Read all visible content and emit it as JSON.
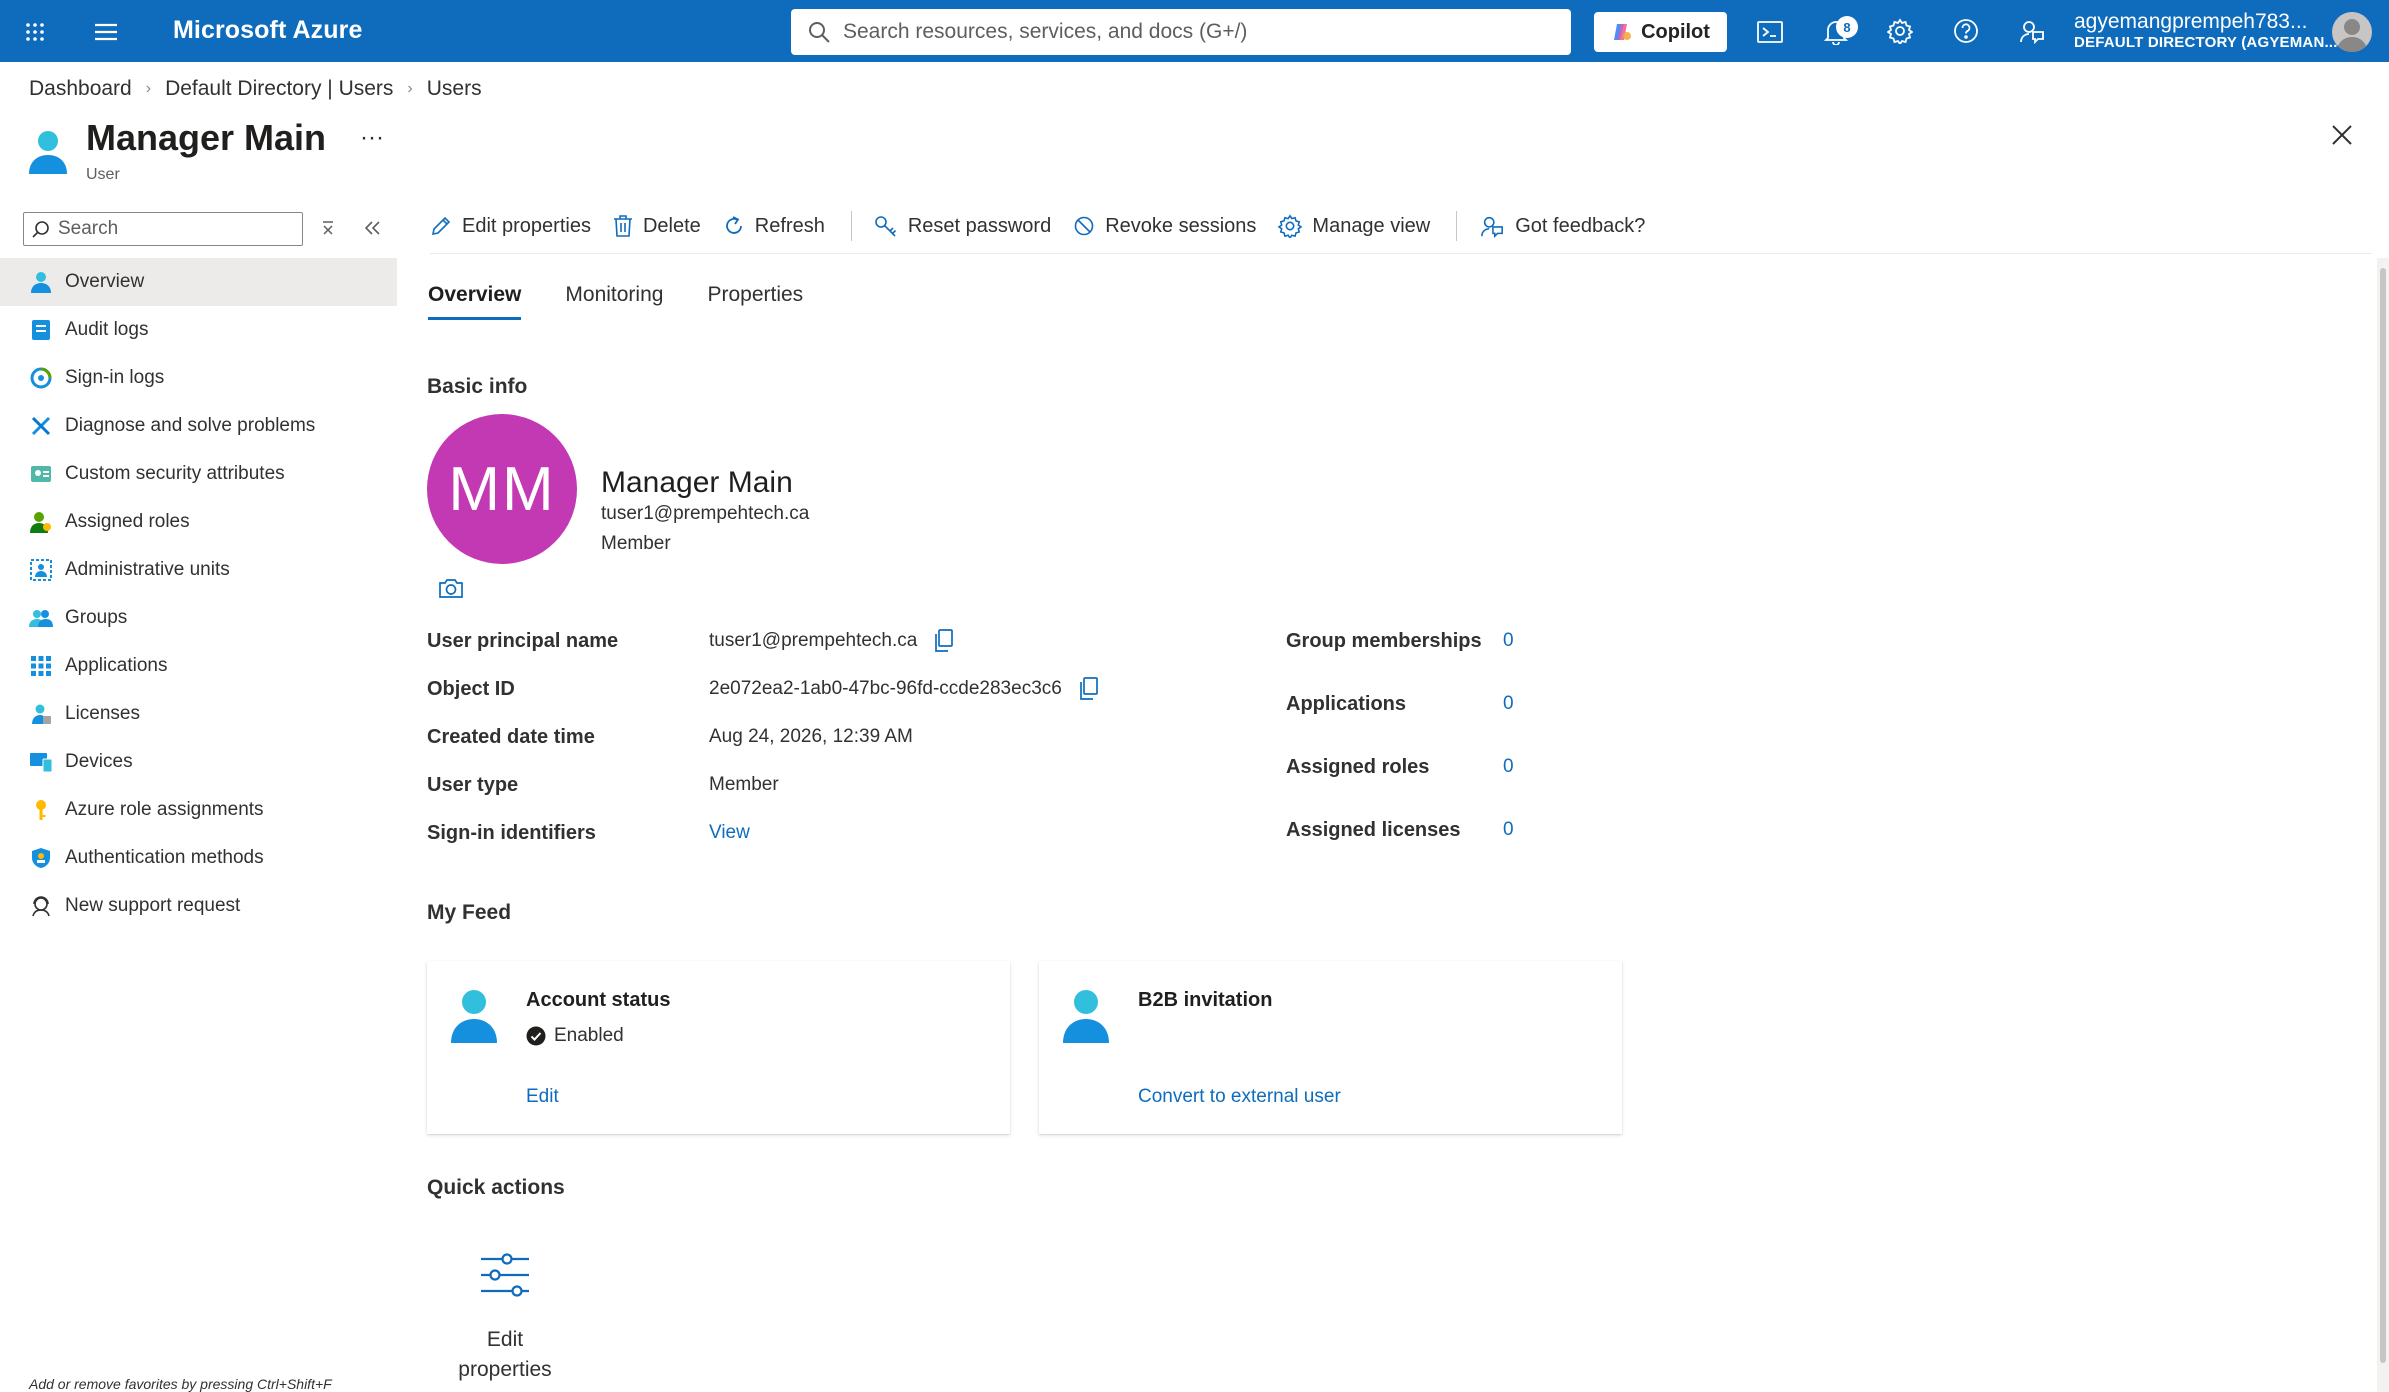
{
  "topbar": {
    "brand": "Microsoft Azure",
    "search_placeholder": "Search resources, services, and docs (G+/)",
    "copilot_label": "Copilot",
    "notification_count": "8",
    "account_name": "agyemangprempeh783...",
    "account_directory": "DEFAULT DIRECTORY (AGYEMAN..."
  },
  "breadcrumb": [
    "Dashboard",
    "Default Directory | Users",
    "Users"
  ],
  "header": {
    "title": "Manager Main",
    "subtitle": "User",
    "more": "···"
  },
  "sidebar": {
    "search_placeholder": "Search",
    "items": [
      {
        "label": "Overview",
        "icon": "user-icon",
        "active": true
      },
      {
        "label": "Audit logs",
        "icon": "audit-log-icon"
      },
      {
        "label": "Sign-in logs",
        "icon": "sign-in-log-icon"
      },
      {
        "label": "Diagnose and solve problems",
        "icon": "wrench-icon"
      },
      {
        "label": "Custom security attributes",
        "icon": "security-attribute-icon"
      },
      {
        "label": "Assigned roles",
        "icon": "assigned-roles-icon"
      },
      {
        "label": "Administrative units",
        "icon": "admin-units-icon"
      },
      {
        "label": "Groups",
        "icon": "groups-icon"
      },
      {
        "label": "Applications",
        "icon": "apps-grid-icon"
      },
      {
        "label": "Licenses",
        "icon": "license-icon"
      },
      {
        "label": "Devices",
        "icon": "devices-icon"
      },
      {
        "label": "Azure role assignments",
        "icon": "key-icon"
      },
      {
        "label": "Authentication methods",
        "icon": "shield-icon"
      },
      {
        "label": "New support request",
        "icon": "support-icon"
      }
    ],
    "favorites_hint": "Add or remove favorites by pressing Ctrl+Shift+F"
  },
  "commands": [
    "Edit properties",
    "Delete",
    "Refresh",
    "Reset password",
    "Revoke sessions",
    "Manage view",
    "Got feedback?"
  ],
  "tabs": [
    "Overview",
    "Monitoring",
    "Properties"
  ],
  "basic_info": {
    "title": "Basic info",
    "initials": "MM",
    "display_name": "Manager Main",
    "email": "tuser1@prempehtech.ca",
    "user_type": "Member",
    "properties": {
      "upn_label": "User principal name",
      "upn_value": "tuser1@prempehtech.ca",
      "object_id_label": "Object ID",
      "object_id_value": "2e072ea2-1ab0-47bc-96fd-ccde283ec3c6",
      "created_label": "Created date time",
      "created_value": "Aug 24, 2026, 12:39 AM",
      "user_type_label": "User type",
      "user_type_value": "Member",
      "sign_in_label": "Sign-in identifiers",
      "sign_in_value": "View"
    },
    "stats": {
      "groups_label": "Group memberships",
      "groups_value": "0",
      "apps_label": "Applications",
      "apps_value": "0",
      "roles_label": "Assigned roles",
      "roles_value": "0",
      "licenses_label": "Assigned licenses",
      "licenses_value": "0"
    }
  },
  "feed": {
    "title": "My Feed",
    "account_status": {
      "title": "Account status",
      "status": "Enabled",
      "link": "Edit"
    },
    "b2b": {
      "title": "B2B invitation",
      "link": "Convert to external user"
    }
  },
  "quick_actions": {
    "title": "Quick actions",
    "edit_label": "Edit properties"
  },
  "colors": {
    "brand": "#0f6cbd",
    "avatar": "#c239b3",
    "link": "#0f6cbd"
  }
}
